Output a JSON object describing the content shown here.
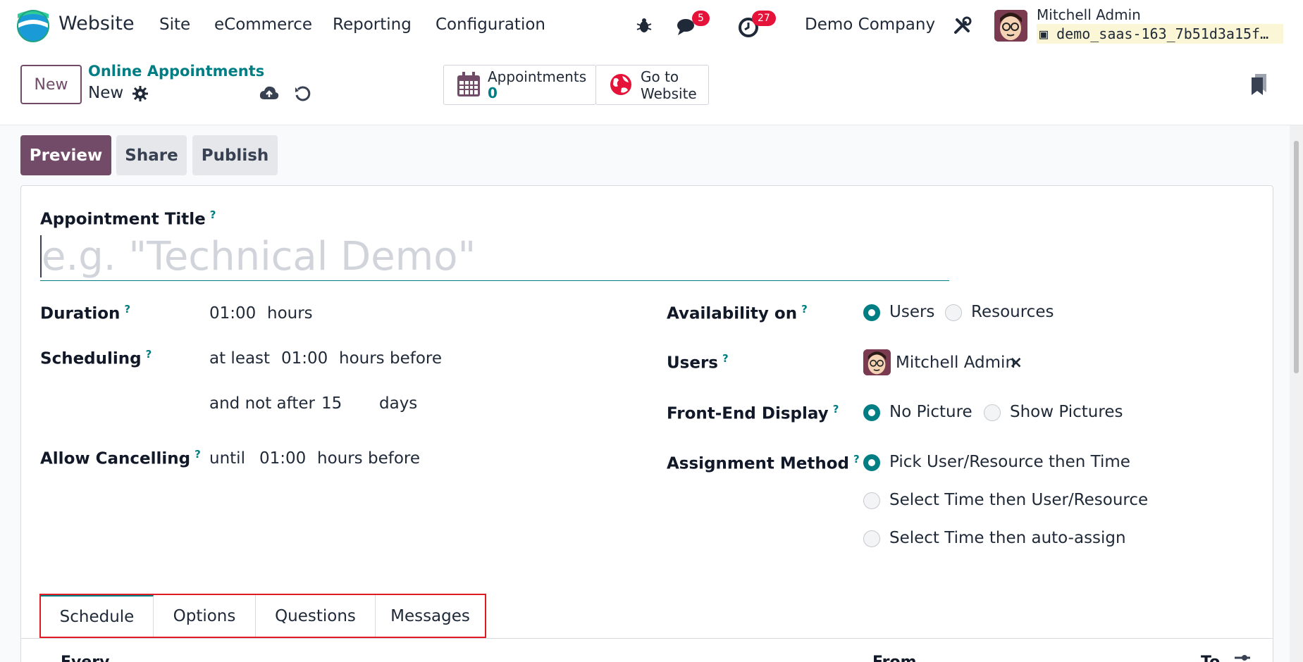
{
  "navbar": {
    "app_name": "Website",
    "menu": [
      "Site",
      "eCommerce",
      "Reporting",
      "Configuration"
    ],
    "messages_count": "5",
    "activities_count": "27",
    "company": "Demo Company",
    "user_name": "Mitchell Admin",
    "database": "demo_saas-163_7b51d3a15f…"
  },
  "control": {
    "new_label": "New",
    "breadcrumb": "Online Appointments",
    "record_name": "New",
    "smart_buttons": {
      "appointments_label": "Appointments",
      "appointments_count": "0",
      "website_label_1": "Go to",
      "website_label_2": "Website"
    }
  },
  "actions": {
    "preview": "Preview",
    "share": "Share",
    "publish": "Publish"
  },
  "form": {
    "title_label": "Appointment Title",
    "title_placeholder": "e.g. \"Technical Demo\"",
    "help_mark": "?",
    "duration": {
      "label": "Duration",
      "value": "01:00",
      "unit": "hours"
    },
    "scheduling": {
      "label": "Scheduling",
      "prefix": "at least",
      "value": "01:00",
      "unit": "hours before",
      "prefix2": "and not after",
      "value2": "15",
      "unit2": "days"
    },
    "cancelling": {
      "label": "Allow Cancelling",
      "prefix": "until",
      "value": "01:00",
      "unit": "hours before"
    },
    "availability": {
      "label": "Availability on",
      "options": [
        "Users",
        "Resources"
      ],
      "selected": "Users"
    },
    "users": {
      "label": "Users",
      "tag": "Mitchell Admin",
      "remove": "×"
    },
    "front_end": {
      "label": "Front-End Display",
      "options": [
        "No Picture",
        "Show Pictures"
      ],
      "selected": "No Picture"
    },
    "assignment": {
      "label": "Assignment Method",
      "options": [
        "Pick User/Resource then Time",
        "Select Time then User/Resource",
        "Select Time then auto-assign"
      ],
      "selected": "Pick User/Resource then Time"
    }
  },
  "tabs": [
    "Schedule",
    "Options",
    "Questions",
    "Messages"
  ],
  "schedule_columns": [
    "Every",
    "From",
    "To"
  ],
  "colors": {
    "primary": "#714b67",
    "accent": "#017e84",
    "badge": "#e5133a",
    "highlight_box": "#e01b24"
  }
}
